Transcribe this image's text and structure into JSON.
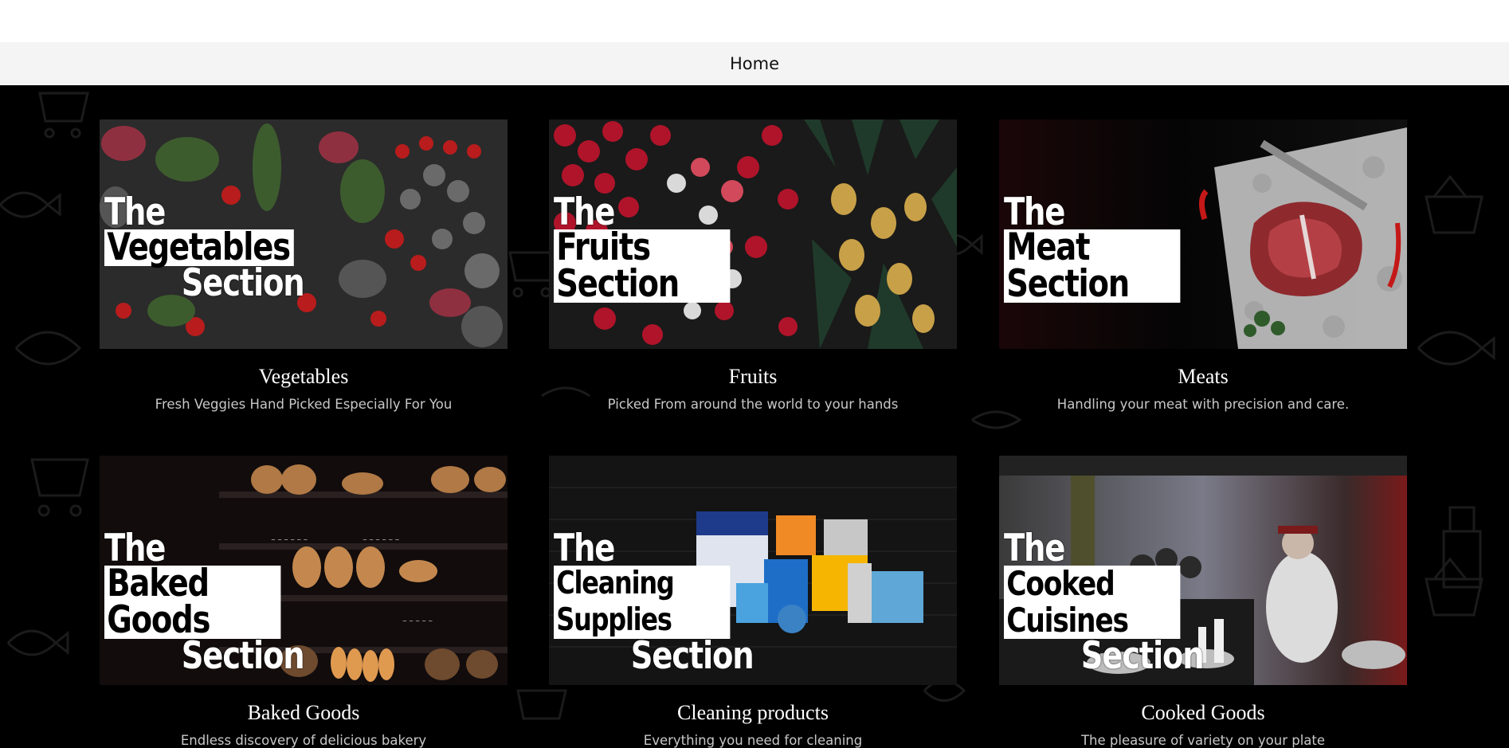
{
  "nav": {
    "home_label": "Home"
  },
  "cards": [
    {
      "title": "Vegetables",
      "description": "Fresh Veggies Hand Picked Especially For You",
      "overlay": {
        "the": "The",
        "boxed": "Vegetables",
        "section": "Section"
      }
    },
    {
      "title": "Fruits",
      "description": "Picked From around the world to your hands",
      "overlay": {
        "the": "The",
        "boxed": "Fruits Section",
        "section": ""
      }
    },
    {
      "title": "Meats",
      "description": "Handling your meat with precision and care.",
      "overlay": {
        "the": "The",
        "boxed": "Meat Section",
        "section": ""
      }
    },
    {
      "title": "Baked Goods",
      "description": "Endless discovery of delicious bakery",
      "overlay": {
        "the": "The",
        "boxed": "Baked Goods",
        "section": "Section"
      }
    },
    {
      "title": "Cleaning products",
      "description": "Everything you need for cleaning",
      "overlay": {
        "the": "The",
        "boxed": "Cleaning Supplies",
        "section": "Section"
      }
    },
    {
      "title": "Cooked Goods",
      "description": "The pleasure of variety on your plate",
      "overlay": {
        "the": "The",
        "boxed": "Cooked Cuisines",
        "section": "Section"
      }
    }
  ]
}
